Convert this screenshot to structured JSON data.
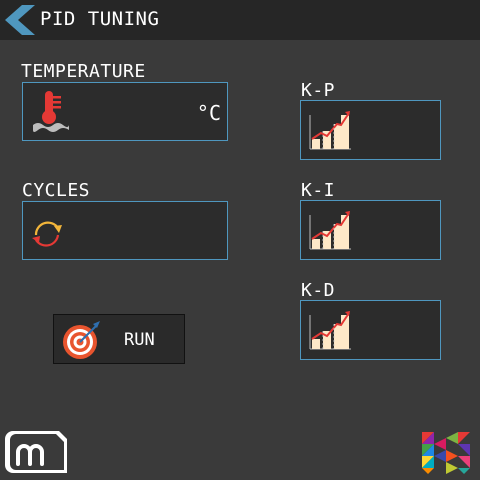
{
  "header": {
    "title": "PID TUNING",
    "back_icon": "back-arrow-icon"
  },
  "temperature": {
    "label": "TEMPERATURE",
    "value": "",
    "unit": "°C",
    "icon": "thermometer-icon"
  },
  "cycles": {
    "label": "CYCLES",
    "value": "",
    "icon": "cycle-icon"
  },
  "kp": {
    "label": "K-P",
    "value": "",
    "icon": "bar-chart-icon"
  },
  "ki": {
    "label": "K-I",
    "value": "",
    "icon": "bar-chart-icon"
  },
  "kd": {
    "label": "K-D",
    "value": "",
    "icon": "bar-chart-icon"
  },
  "run": {
    "label": "RUN",
    "icon": "target-icon"
  },
  "footer": {
    "left_logo": "m-logo",
    "right_logo": "k-logo"
  },
  "colors": {
    "accent": "#4f97bf",
    "header": "#262626",
    "background": "#3a3a3a"
  }
}
